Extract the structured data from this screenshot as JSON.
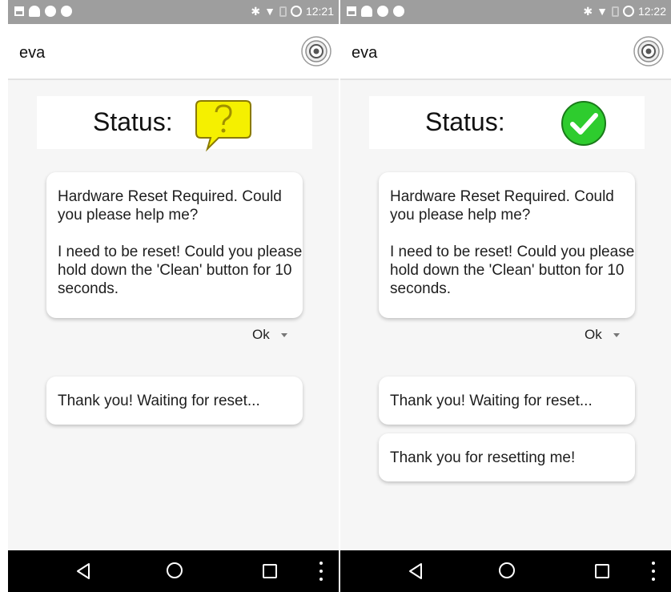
{
  "screens": [
    {
      "status_bar": {
        "time": "12:21",
        "bluetooth_icon": "bluetooth-icon",
        "wifi_icon": "wifi-icon",
        "ring_icon": "ring-icon"
      },
      "app_bar": {
        "title": "eva",
        "icon": "target-icon"
      },
      "status": {
        "label": "Status:",
        "icon": "question-bubble-icon",
        "icon_color": "#f5f000"
      },
      "message": {
        "line1": "Hardware Reset Required. Could you please help me?",
        "line2": "I need to be reset! Could you please hold down the 'Clean' button for 10 seconds."
      },
      "reply_select": {
        "value": "Ok"
      },
      "responses": [
        "Thank you! Waiting for reset..."
      ],
      "nav_icons": [
        "back-icon",
        "home-icon",
        "recents-icon",
        "more-vert-icon"
      ]
    },
    {
      "status_bar": {
        "time": "12:22",
        "bluetooth_icon": "bluetooth-icon",
        "wifi_icon": "wifi-icon",
        "ring_icon": "ring-icon"
      },
      "app_bar": {
        "title": "eva",
        "icon": "target-icon"
      },
      "status": {
        "label": "Status:",
        "icon": "check-circle-icon",
        "icon_color": "#2ecc2e"
      },
      "message": {
        "line1": "Hardware Reset Required. Could you please help me?",
        "line2": "I need to be reset! Could you please hold down the 'Clean' button for 10 seconds."
      },
      "reply_select": {
        "value": "Ok"
      },
      "responses": [
        "Thank you! Waiting for reset...",
        "Thank you for resetting me!"
      ],
      "nav_icons": [
        "back-icon",
        "home-icon",
        "recents-icon",
        "more-vert-icon"
      ]
    }
  ]
}
